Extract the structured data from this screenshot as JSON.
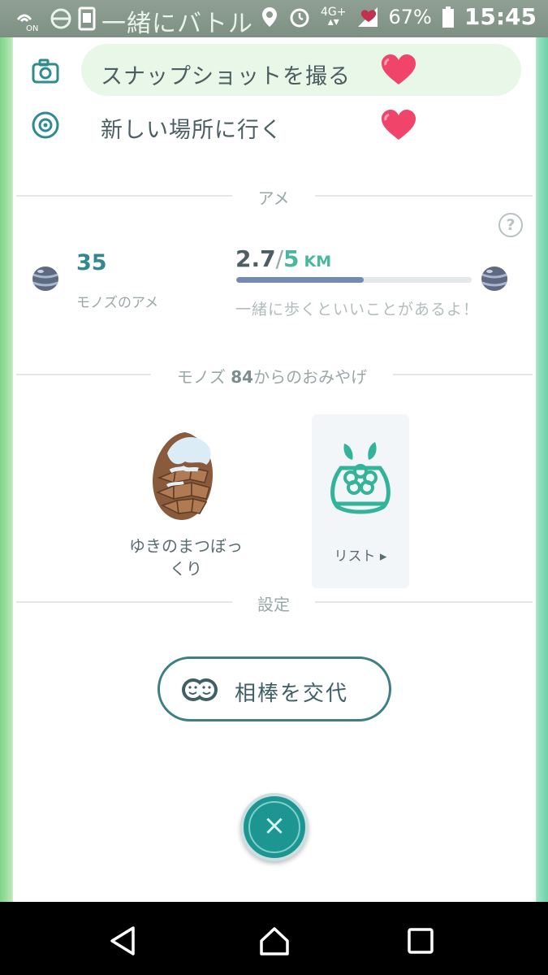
{
  "status_bar": {
    "title": "一緒にバトル",
    "network": "4G+",
    "battery_percent": "67%",
    "time": "15:45",
    "nfc_label": "ON"
  },
  "menu": {
    "snapshot_label": "スナップショットを撮る",
    "new_place_label": "新しい場所に行く"
  },
  "candy_section": {
    "title": "アメ",
    "help_label": "?",
    "count": "35",
    "candy_name": "モノズのアメ",
    "distance_walked": "2.7",
    "separator": "/",
    "distance_goal": "5",
    "distance_unit": "KM",
    "progress_fraction": 0.54,
    "walk_hint": "一緒に歩くといいことがあるよ！"
  },
  "souvenir_section": {
    "title_prefix": "モノズ ",
    "title_number": "84",
    "title_suffix": "からのおみやげ",
    "item_label_line1": "ゆきのまつぼっ",
    "item_label_line2": "くり",
    "list_label": "リスト ▸"
  },
  "settings_section": {
    "title": "設定",
    "swap_buddy_label": "相棒を交代"
  },
  "close_glyph": "×",
  "colors": {
    "accent_teal": "#1d9693",
    "progress_fill": "#7489b8",
    "heart": "#f0446b",
    "pill_bg": "#e9f7e8"
  }
}
